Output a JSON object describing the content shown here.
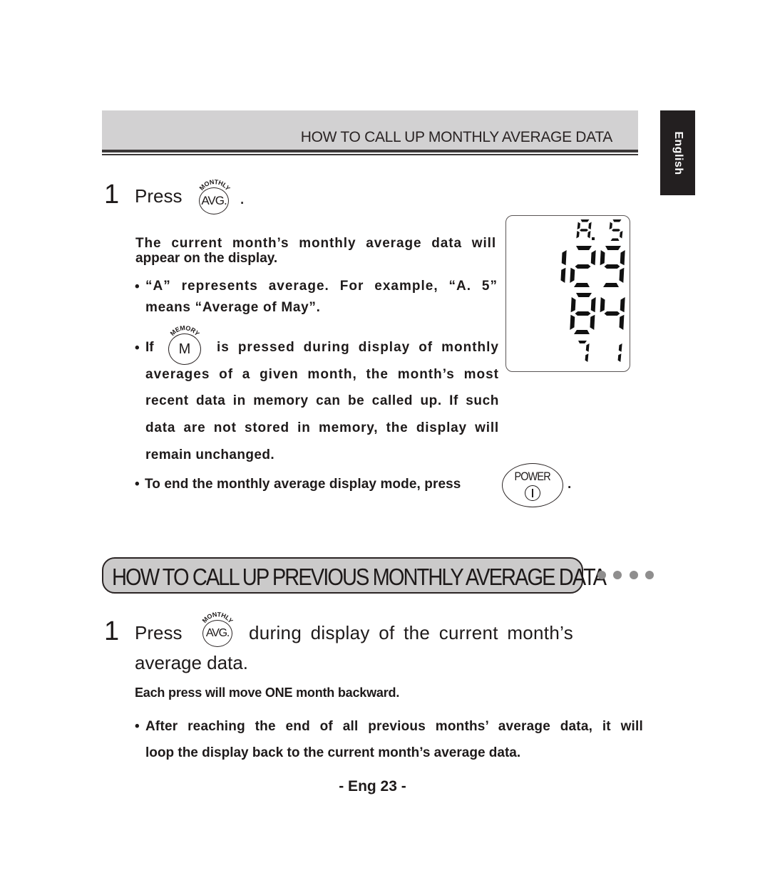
{
  "header": {
    "title": "HOW TO CALL UP MONTHLY AVERAGE DATA",
    "language_tab": "English"
  },
  "section1": {
    "step": {
      "number": "1",
      "press_label": "Press",
      "button": {
        "arc_label": "MONTHLY",
        "label": "AVG.",
        "icon": "avg-button-icon"
      },
      "trailing": "."
    },
    "intro_line1": "The current month’s monthly average data will",
    "intro_line2": "appear on the display.",
    "bullet_a_line1": "“A” represents average. For example, “A. 5”",
    "bullet_a_line2": "means “Average of May”.",
    "bullet_m": {
      "prefix": "If",
      "button": {
        "arc_label": "MEMORY",
        "label": "M",
        "icon": "memory-button-icon"
      },
      "line1_rest": "is pressed during display of monthly",
      "line2": "averages of a given month, the month’s most",
      "line3": "recent data in memory can be called up. If such",
      "line4": "data are not stored in memory, the display will",
      "line5": "remain unchanged."
    },
    "bullet_power": {
      "text": "To end the monthly average display mode, press",
      "button": {
        "label": "POWER",
        "icon": "power-button-icon"
      },
      "trailing": "."
    },
    "bullet_char": "•"
  },
  "lcd_display": {
    "month_indicator": "A. 5",
    "systolic": "129",
    "diastolic": "84",
    "pulse": "71"
  },
  "section2": {
    "title": "HOW TO CALL UP PREVIOUS MONTHLY AVERAGE DATA",
    "step": {
      "number": "1",
      "press_label": "Press",
      "button": {
        "arc_label": "MONTHLY",
        "label": "AVG.",
        "icon": "avg-button-icon"
      },
      "rest_line1": "during display of the current month’s",
      "line2": "average data."
    },
    "note": "Each press will move ONE month backward.",
    "bullet_line1": "After reaching the end of all previous months’ average data, it will",
    "bullet_line2": "loop the display back to the current month’s average data."
  },
  "footer": {
    "page_label": "- Eng 23 -"
  }
}
